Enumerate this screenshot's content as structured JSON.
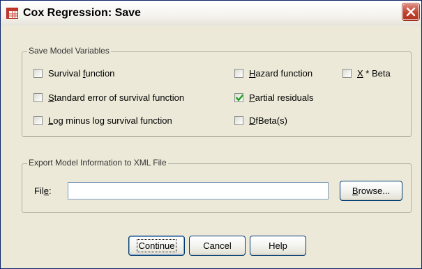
{
  "window": {
    "title": "Cox Regression: Save",
    "icon": "spss-table-icon",
    "close_icon": "close-icon"
  },
  "save_group": {
    "legend": "Save Model Variables",
    "checkboxes": [
      {
        "pre": "Survival ",
        "mn": "f",
        "post": "unction",
        "checked": false
      },
      {
        "pre": "",
        "mn": "S",
        "post": "tandard error of survival function",
        "checked": false
      },
      {
        "pre": "",
        "mn": "L",
        "post": "og minus log survival function",
        "checked": false
      },
      {
        "pre": "",
        "mn": "H",
        "post": "azard function",
        "checked": false
      },
      {
        "pre": "",
        "mn": "P",
        "post": "artial residuals",
        "checked": true
      },
      {
        "pre": "",
        "mn": "D",
        "post": "fBeta(s)",
        "checked": false
      },
      {
        "pre": "",
        "mn": "X",
        "post": " * Beta",
        "checked": false
      }
    ]
  },
  "export_group": {
    "legend": "Export Model Information to XML File",
    "file_label_pre": "Fil",
    "file_label_mn": "e",
    "file_label_post": ":",
    "file_value": "",
    "browse_pre": "",
    "browse_mn": "B",
    "browse_post": "rowse..."
  },
  "buttons": {
    "continue": "Continue",
    "cancel": "Cancel",
    "help": "Help"
  }
}
